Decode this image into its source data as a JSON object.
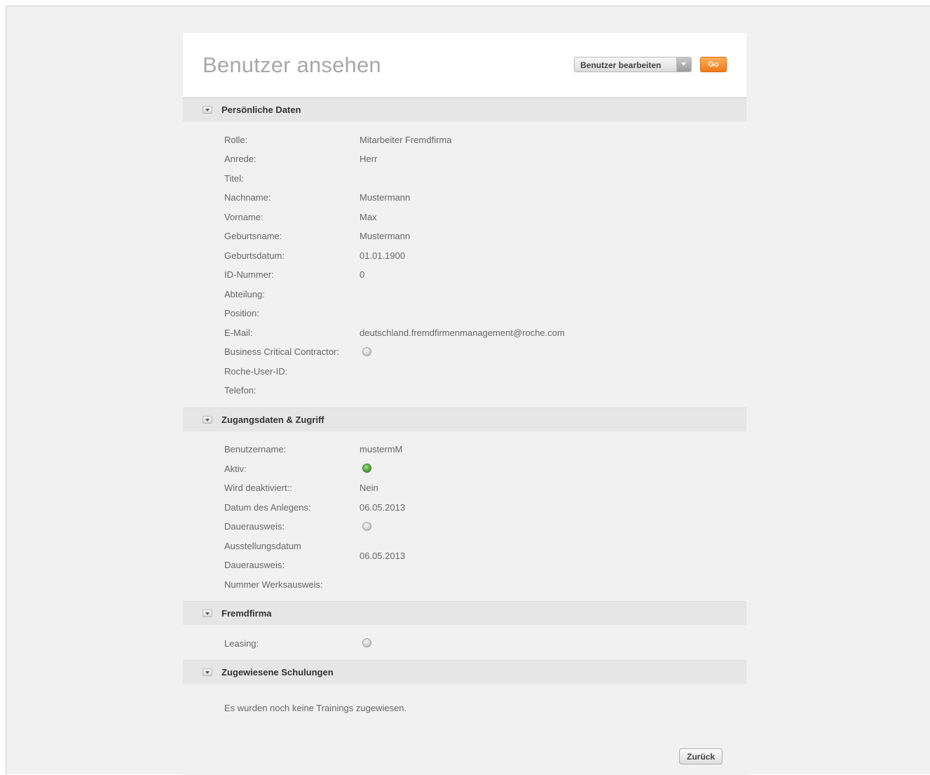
{
  "header": {
    "title": "Benutzer ansehen",
    "action_select": "Benutzer bearbeiten",
    "go_label": "Go"
  },
  "sections": {
    "personal": {
      "title": "Persönliche Daten",
      "rows": [
        {
          "label": "Rolle:",
          "value": "Mitarbeiter Fremdfirma"
        },
        {
          "label": "Anrede:",
          "value": "Herr"
        },
        {
          "label": "Titel:",
          "value": ""
        },
        {
          "label": "Nachname:",
          "value": "Mustermann"
        },
        {
          "label": "Vorname:",
          "value": "Max"
        },
        {
          "label": "Geburtsname:",
          "value": "Mustermann"
        },
        {
          "label": "Geburtsdatum:",
          "value": "01.01.1900"
        },
        {
          "label": "ID-Nummer:",
          "value": "0"
        },
        {
          "label": "Abteilung:",
          "value": ""
        },
        {
          "label": "Position:",
          "value": ""
        },
        {
          "label": "E-Mail:",
          "value": "deutschland.fremdfirmenmanagement@roche.com"
        },
        {
          "label": "Business Critical Contractor:",
          "indicator": "off"
        },
        {
          "label": "Roche-User-ID:",
          "value": ""
        },
        {
          "label": "Telefon:",
          "value": ""
        }
      ]
    },
    "access": {
      "title": "Zugangsdaten & Zugriff",
      "rows": [
        {
          "label": "Benutzername:",
          "value": "mustermM"
        },
        {
          "label": "Aktiv:",
          "indicator": "on"
        },
        {
          "label": "Wird deaktiviert::",
          "value": "Nein"
        },
        {
          "label": "Datum des Anlegens:",
          "value": "06.05.2013"
        },
        {
          "label": "Dauerausweis:",
          "indicator": "off"
        },
        {
          "label_line1": "Ausstellungsdatum",
          "label_line2": "Dauerausweis:",
          "value": "06.05.2013"
        },
        {
          "label": "Nummer Werksausweis:",
          "value": ""
        }
      ]
    },
    "company": {
      "title": "Fremdfirma",
      "rows": [
        {
          "label": "Leasing:",
          "indicator": "off"
        }
      ]
    },
    "trainings": {
      "title": "Zugewiesene Schulungen",
      "empty_message": "Es wurden noch keine Trainings zugewiesen."
    }
  },
  "footer": {
    "back_label": "Zurück"
  }
}
